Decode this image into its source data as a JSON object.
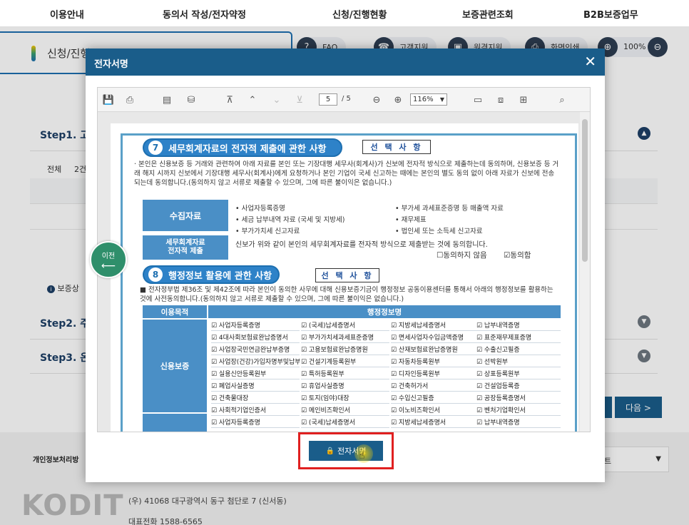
{
  "topnav": [
    "이용안내",
    "동의서 작성/전자약정",
    "신청/진행현황",
    "보증관련조회",
    "B2B보증업무"
  ],
  "page": {
    "title_partial": "신청/진행",
    "tools": [
      {
        "label": "FAQ",
        "icon": "question-icon"
      },
      {
        "label": "고객지원",
        "icon": "headset-icon"
      },
      {
        "label": "원격지원",
        "icon": "remote-icon"
      },
      {
        "label": "화면인쇄",
        "icon": "print-icon"
      }
    ],
    "zoom": "100%",
    "step1": "Step1. 고",
    "step2": "Step2. 주",
    "step3": "Step3. 온",
    "all_label": "전체",
    "count_partial": "2건",
    "guarantee_partial": "보증상",
    "next": "다음 >"
  },
  "footer": {
    "privacy": "개인정보처리방",
    "select_partial": "트",
    "logo": "KODIT",
    "address": "(우) 41068 대구광역시 동구 첨단로 7 (신서동)",
    "tel": "대표전화 1588-6565"
  },
  "modal": {
    "title": "전자서명",
    "close": "✕",
    "prev": "이전",
    "sign_button": "전자서명",
    "viewer": {
      "page_current": "5",
      "page_total": "/ 5",
      "zoom": "116%"
    },
    "sec7": {
      "num": "7",
      "title": "세무회계자료의 전자적 제출에 관한 사항",
      "badge": "선 택 사 항",
      "para": "· 본인은 신용보증 등 거래와 관련하여 아래 자료를 본인 또는 기장대행 세무사(회계사)가 신보에 전자적 방식으로 제출하는데 동의하며, 신용보증 등 거래 해지 시까지 신보에서 기장대행 세무사(회계사)에게 요청하거나 본인 기업이 국세 신고하는 때에는 본인의 별도 동의 없이 아래 자료가 신보에 전송되는데 동의합니다.(동의하지 않고 서류로 제출할 수 있으며, 그에 따른 불이익은 없습니다.)",
      "collect_label": "수집자료",
      "items_left": [
        "• 사업자등록증명",
        "• 세금 납부내역 자료 (국세 및 지방세)",
        "• 부가가치세 신고자료"
      ],
      "items_right": [
        "• 부가세 과세표준증명 등 매출액 자료",
        "• 재무제표",
        "• 법인세 또는 소득세 신고자료"
      ],
      "submit_label": "세무회계자료\n전자적 제출",
      "submit_text": "신보가 위와 같이 본인의 세무회계자료를 전자적 방식으로 제출받는 것에 동의합니다.",
      "disagree": "☐동의하지 않음",
      "agree": "☑동의함"
    },
    "sec8": {
      "num": "8",
      "title": "행정정보 활용에 관한 사항",
      "badge": "선 택 사 항",
      "para": "■ 전자정부법 제36조 및 제42조에 따라 본인이 동의한 사무에 대해 신용보증기금이 행정정보 공동이용센터를 통해서 아래의 행정정보를 활용하는 것에 사전동의합니다.(동의하지 않고 서류로 제출할 수 있으며, 그에 따른 불이익은 없습니다.)",
      "purpose_label": "이용목적",
      "info_label": "행정정보명",
      "credit_label": "신용보증",
      "grid": [
        [
          "사업자등록증명",
          "(국세)납세증명서",
          "지방세납세증명서",
          "납부내역증명"
        ],
        [
          "4대사회보험료완납증명서",
          "부가가치세과세표준증명",
          "면세사업자수입금액증명",
          "표준재무제표증명"
        ],
        [
          "사업장국민연금완납부증명",
          "고용보험료완납증명원",
          "산재보험료완납증명원",
          "수출신고필증"
        ],
        [
          "사업장(건강)가입자명부및납부확인서",
          "건설기계등록원부",
          "자동차등록원부",
          "선박원부"
        ],
        [
          "실용신안등록원부",
          "특허등록원부",
          "디자인등록원부",
          "상표등록원부"
        ],
        [
          "폐업사실증명",
          "휴업사실증명",
          "건축허가서",
          "건설업등록증"
        ],
        [
          "건축물대장",
          "토지(임야)대장",
          "수입신고필증",
          "공장등록증명서"
        ],
        [
          "사회적기업인증서",
          "메인비즈확인서",
          "이노비즈확인서",
          "벤처기업확인서"
        ],
        [
          "사업자등록증명",
          "(국세)납세증명서",
          "지방세납세증명서",
          "납부내역증명"
        ]
      ]
    }
  }
}
